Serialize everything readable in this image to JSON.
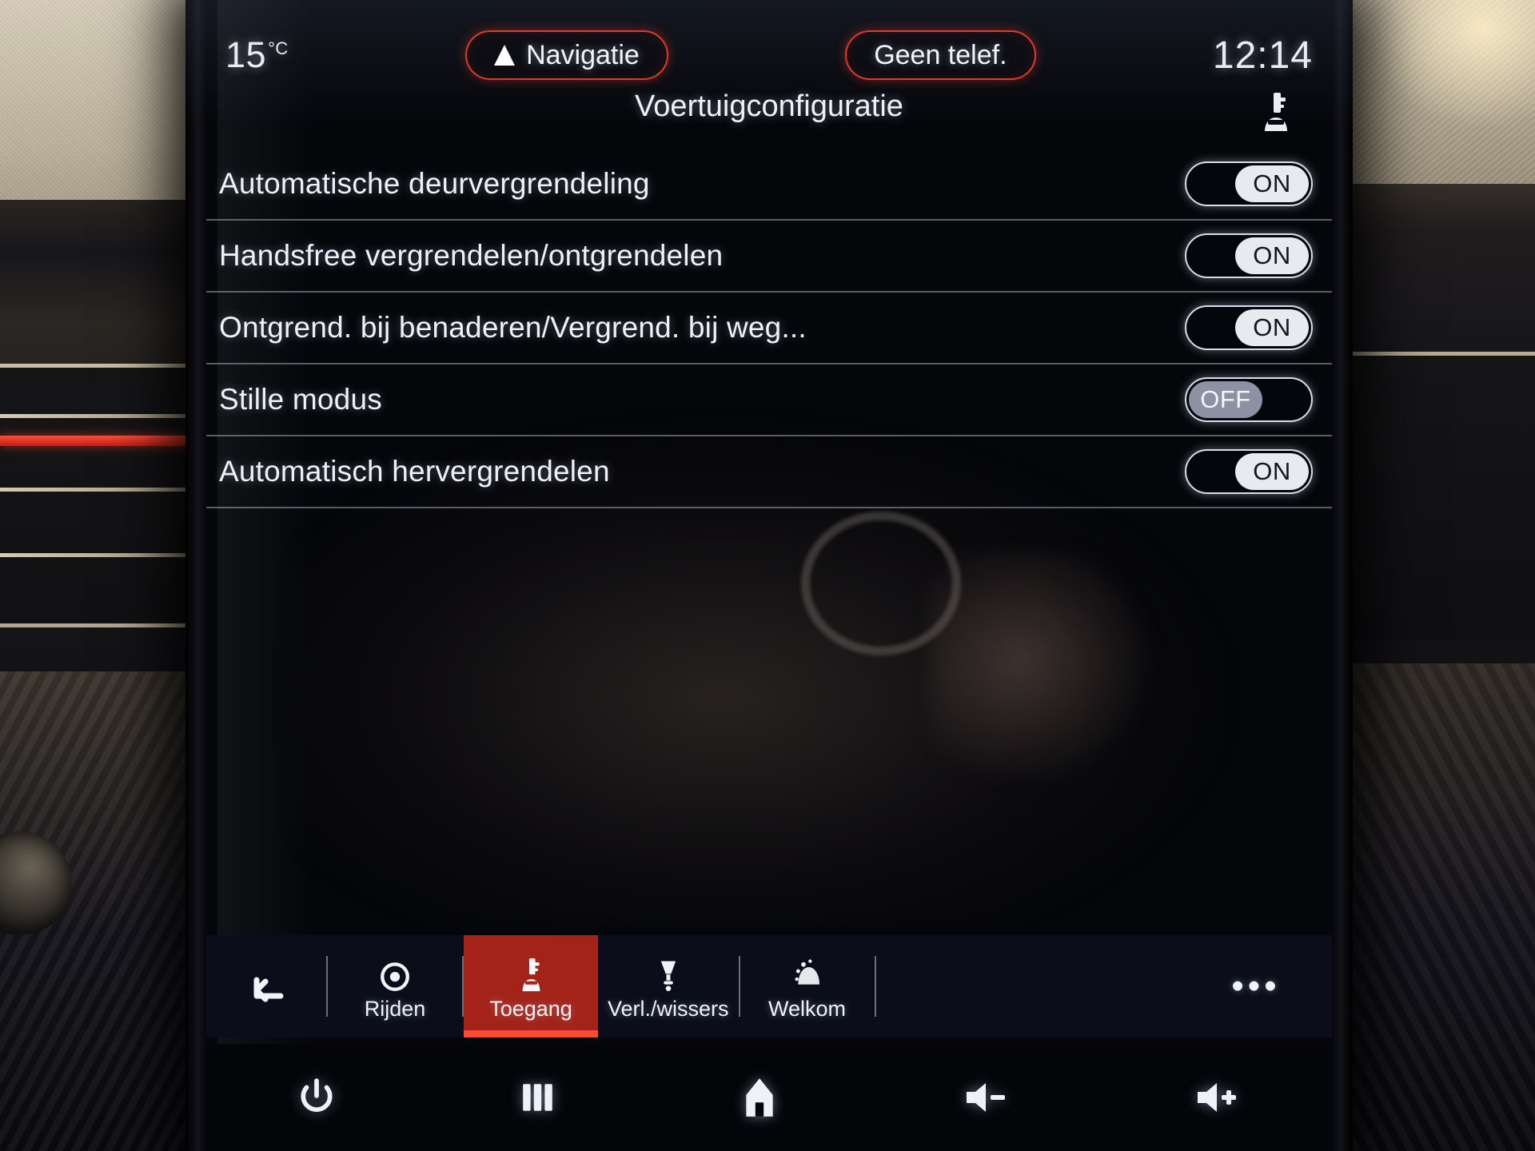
{
  "status_bar": {
    "temperature": "15",
    "temperature_unit": "°C",
    "navigation_label": "Navigatie",
    "navigation_icon": "navigation-arrow-icon",
    "phone_label": "Geen telef.",
    "clock": "12:14",
    "accent_color": "#e0392c"
  },
  "header": {
    "title": "Voertuigconfiguratie",
    "icon": "car-key-icon"
  },
  "settings": [
    {
      "label": "Automatische deurvergrendeling",
      "state": "ON"
    },
    {
      "label": "Handsfree vergrendelen/ontgrendelen",
      "state": "ON"
    },
    {
      "label": "Ontgrend. bij benaderen/Vergrend. bij weg...",
      "state": "ON"
    },
    {
      "label": "Stille modus",
      "state": "OFF"
    },
    {
      "label": "Automatisch hervergrendelen",
      "state": "ON"
    }
  ],
  "tab_bar": {
    "back_icon": "back-arrow-icon",
    "more_label": "•••",
    "active_color": "#a32318",
    "tabs": [
      {
        "label": "Rijden",
        "icon": "steering-wheel-icon",
        "active": false
      },
      {
        "label": "Toegang",
        "icon": "car-key-icon",
        "active": true
      },
      {
        "label": "Verl./wissers",
        "icon": "headlight-wiper-icon",
        "active": false
      },
      {
        "label": "Welkom",
        "icon": "welcome-light-icon",
        "active": false
      }
    ]
  },
  "hardware_bar": {
    "buttons": [
      {
        "name": "power-button",
        "icon": "power-icon"
      },
      {
        "name": "apps-button",
        "icon": "grid-apps-icon"
      },
      {
        "name": "home-button",
        "icon": "home-icon"
      },
      {
        "name": "volume-down-button",
        "icon": "volume-minus-icon"
      },
      {
        "name": "volume-up-button",
        "icon": "volume-plus-icon"
      }
    ]
  }
}
